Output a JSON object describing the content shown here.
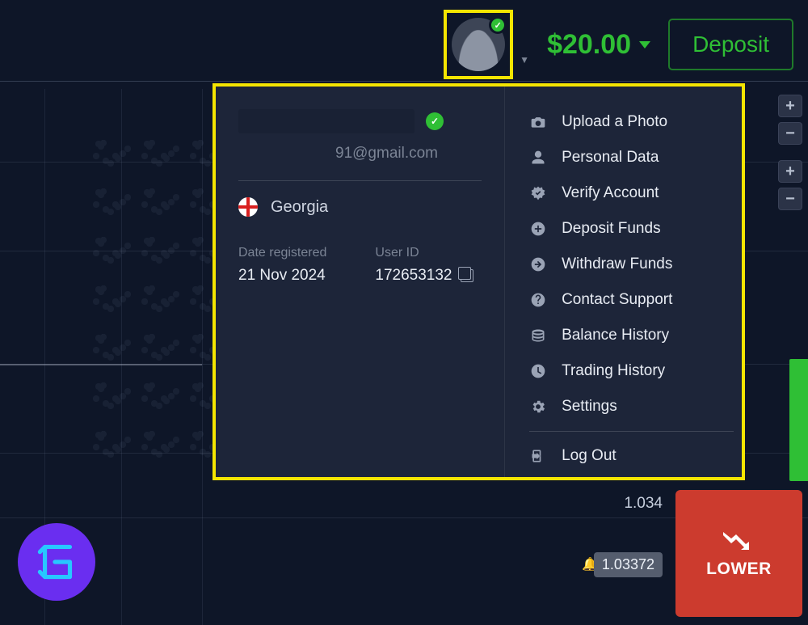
{
  "header": {
    "balance": "$20.00",
    "deposit_label": "Deposit"
  },
  "profile": {
    "email_suffix": "91@gmail.com",
    "country": "Georgia",
    "date_registered_label": "Date registered",
    "date_registered": "21 Nov 2024",
    "user_id_label": "User ID",
    "user_id": "172653132"
  },
  "menu": {
    "upload_photo": "Upload a Photo",
    "personal_data": "Personal Data",
    "verify_account": "Verify Account",
    "deposit_funds": "Deposit Funds",
    "withdraw_funds": "Withdraw Funds",
    "contact_support": "Contact Support",
    "balance_history": "Balance History",
    "trading_history": "Trading History",
    "settings": "Settings",
    "log_out": "Log Out"
  },
  "chart": {
    "price_label_1": "1.034",
    "price_label_2": "1.03372"
  },
  "actions": {
    "lower": "LOWER"
  }
}
